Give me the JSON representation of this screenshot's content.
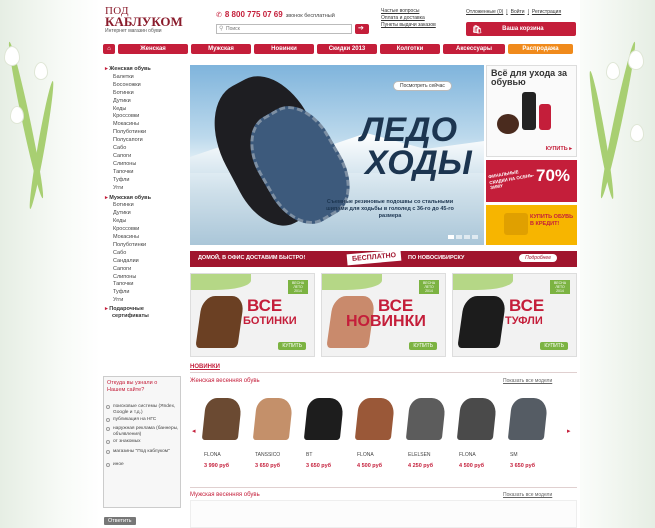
{
  "logo": {
    "line1": "ПОД",
    "line2": "КАБЛУКОМ",
    "tagline": "Интернет магазин обуви"
  },
  "phone": {
    "number": "8 800 775 07 69",
    "note": "звонок бесплатный"
  },
  "search": {
    "placeholder": "Поиск"
  },
  "info_links": [
    "Частые вопросы",
    "Оплата и доставка",
    "Пункты выдачи заказов"
  ],
  "user_links": [
    "Отложенные (0)",
    "Войти",
    "Регистрация"
  ],
  "cart": {
    "label": "Ваша корзина"
  },
  "nav": [
    "Женская",
    "Мужская",
    "Новинки",
    "Скидки 2013",
    "Колготки",
    "Аксессуары",
    "Распродажа"
  ],
  "sidebar": {
    "women_title": "Женская обувь",
    "women": [
      "Балетки",
      "Босоножки",
      "Ботинки",
      "Дутики",
      "Кеды",
      "Кроссовки",
      "Мокасины",
      "Полуботинки",
      "Полусапоги",
      "Сабо",
      "Сапоги",
      "Слипоны",
      "Тапочки",
      "Туфли",
      "Угги"
    ],
    "men_title": "Мужская обувь",
    "men": [
      "Ботинки",
      "Дутики",
      "Кеды",
      "Кроссовки",
      "Мокасины",
      "Полуботинки",
      "Сабо",
      "Сандалии",
      "Сапоги",
      "Слипоны",
      "Тапочки",
      "Туфли",
      "Угги"
    ],
    "gifts": [
      "Подарочные",
      "сертификаты"
    ]
  },
  "poll": {
    "question": "Откуда вы узнали о Нашем сайте?",
    "options": [
      "поисковые системы (Яndex, Google и т.д.)",
      "публикация на НГС",
      "наружная реклама (баннеры, объявления)",
      "от знакомых",
      "магазины \"Под каблуком\"",
      "иное"
    ],
    "submit": "Ответить"
  },
  "hero": {
    "title_line1": "ЛЕДО",
    "title_line2": "ХОДЫ",
    "caption": "Съемные резиновые подошвы со стальными шипами для ходьбы в гололед с 36-го до 45-го размера",
    "cta": "Посмотреть сейчас"
  },
  "side_banners": {
    "care": {
      "title": "Всё для ухода за обувью",
      "cta": "КУПИТЬ"
    },
    "sale": {
      "text": "ФИНАЛЬНЫЕ СКИДКИ НА ОСЕНЬ-ЗИМУ",
      "percent": "70%"
    },
    "credit": {
      "text": "КУПИТЬ ОБУВЬ В КРЕДИТ!"
    }
  },
  "delivery": {
    "left": "ДОМОЙ, В ОФИС ДОСТАВИМ БЫСТРО!",
    "center": "БЕСПЛАТНО",
    "right": "ПО НОВОСИБИРСКУ",
    "more": "Подробнее"
  },
  "promos": [
    {
      "line1": "ВСЕ",
      "line2": "БОТИНКИ",
      "badge": "ВЕСНА ЛЕТО 2014",
      "button": "КУПИТЬ"
    },
    {
      "line1": "ВСЕ",
      "line2": "НОВИНКИ",
      "badge": "ВЕСНА ЛЕТО 2014",
      "button": "КУПИТЬ"
    },
    {
      "line1": "ВСЕ",
      "line2": "ТУФЛИ",
      "badge": "ВЕСНА ЛЕТО 2014",
      "button": "КУПИТЬ"
    }
  ],
  "new_heading": "НОВИНКИ",
  "women_section": {
    "title": "Женская весенняя обувь",
    "show_all": "Показать все модели"
  },
  "products": [
    {
      "brand": "FLONA",
      "price": "3 990 руб",
      "color": "#6b4a32"
    },
    {
      "brand": "TANSSICO",
      "price": "3 650 руб",
      "color": "#c4906a"
    },
    {
      "brand": "BT",
      "price": "3 650 руб",
      "color": "#1d1d1d"
    },
    {
      "brand": "FLONA",
      "price": "4 500 руб",
      "color": "#9a5838"
    },
    {
      "brand": "ELELSEN",
      "price": "4 250 руб",
      "color": "#5c5c5c"
    },
    {
      "brand": "FLONA",
      "price": "4 500 руб",
      "color": "#4a4a4a"
    },
    {
      "brand": "SM",
      "price": "3 650 руб",
      "color": "#555c64"
    }
  ],
  "men_section": {
    "title": "Мужская весенняя обувь",
    "show_all": "Показать все модели"
  }
}
